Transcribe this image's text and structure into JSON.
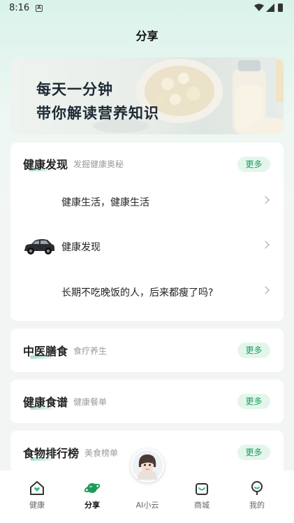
{
  "status_bar": {
    "time": "8:16",
    "notification_letter": "A"
  },
  "header": {
    "title": "分享"
  },
  "banner": {
    "line1": "每天一分钟",
    "line2": "带你解读营养知识"
  },
  "discover": {
    "title": "健康发现",
    "subtitle": "发掘健康奥秘",
    "more_label": "更多",
    "items": [
      {
        "text": "健康生活，健康生活",
        "thumbnail": "none"
      },
      {
        "text": "健康发现",
        "thumbnail": "car-image"
      },
      {
        "text": "长期不吃晚饭的人，后来都瘦了吗?",
        "thumbnail": "none"
      }
    ]
  },
  "tcm": {
    "title": "中医膳食",
    "subtitle": "食疗养生",
    "more_label": "更多"
  },
  "recipes": {
    "title": "健康食谱",
    "subtitle": "健康餐单",
    "more_label": "更多"
  },
  "ranking": {
    "title": "食物排行榜",
    "subtitle": "美食榜单",
    "more_label": "更多"
  },
  "bottom_nav": {
    "items": [
      {
        "label": "健康",
        "icon": "home-heart-icon",
        "active": false
      },
      {
        "label": "分享",
        "icon": "planet-icon",
        "active": true
      },
      {
        "label": "AI小云",
        "icon": "ai-avatar",
        "active": false
      },
      {
        "label": "商城",
        "icon": "shopping-bag-icon",
        "active": false
      },
      {
        "label": "我的",
        "icon": "profile-icon",
        "active": false
      }
    ]
  },
  "colors": {
    "accent": "#1e9d5c",
    "accent_bg": "#e4f6ec",
    "header_gradient_top": "#d9f3ea",
    "page_bg": "#f3f5f4"
  }
}
